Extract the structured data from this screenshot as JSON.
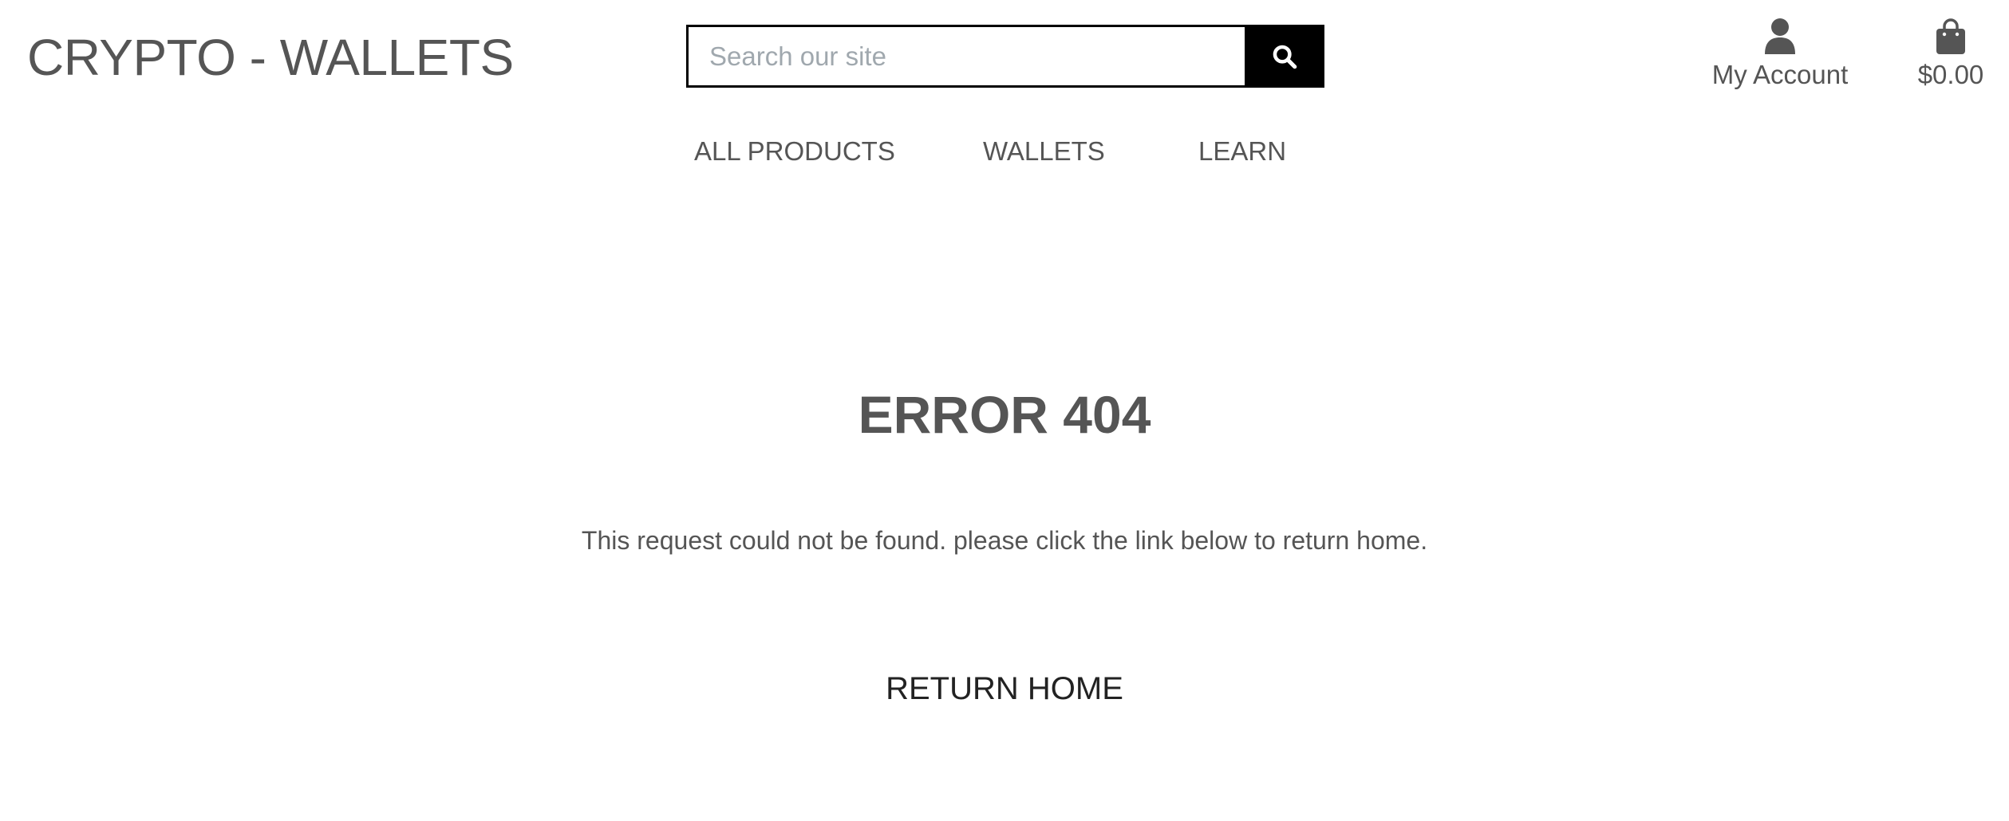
{
  "header": {
    "logo": "CRYPTO - WALLETS",
    "search": {
      "placeholder": "Search our site",
      "value": "",
      "button_icon": "search-icon"
    },
    "account": {
      "icon": "user-icon",
      "label": "My Account"
    },
    "bag": {
      "icon": "shopping-bag-icon",
      "total": "$0.00"
    }
  },
  "nav": {
    "items": [
      {
        "label": "ALL PRODUCTS"
      },
      {
        "label": "WALLETS"
      },
      {
        "label": "LEARN"
      }
    ]
  },
  "main": {
    "title": "ERROR 404",
    "message": "This request could not be found. please click the link below to return home.",
    "return_link": "RETURN HOME"
  },
  "colors": {
    "text": "#555555",
    "search_button": "#000000",
    "placeholder": "#a0a8ae",
    "background": "#ffffff"
  }
}
